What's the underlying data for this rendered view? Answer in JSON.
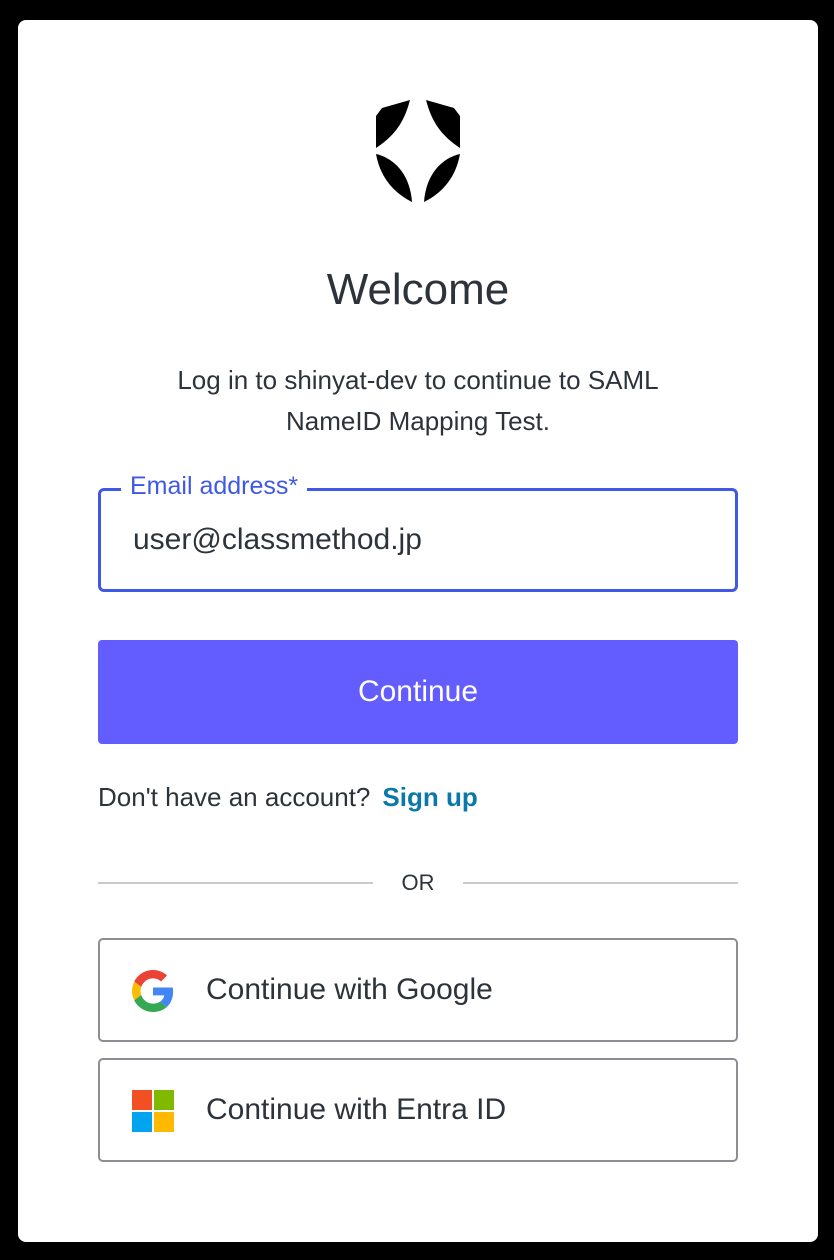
{
  "header": {
    "title": "Welcome",
    "subtitle": "Log in to shinyat-dev to continue to SAML NameID Mapping Test."
  },
  "form": {
    "email_label": "Email address*",
    "email_value": "user@classmethod.jp",
    "continue_label": "Continue"
  },
  "signup": {
    "prompt": "Don't have an account?",
    "link_label": "Sign up"
  },
  "divider": {
    "text": "OR"
  },
  "social": {
    "google_label": "Continue with Google",
    "entra_label": "Continue with Entra ID"
  },
  "icons": {
    "logo": "shield-logo-icon",
    "google": "google-icon",
    "entra": "microsoft-icon"
  },
  "colors": {
    "primary_button": "#635dff",
    "focus_border": "#3f59e4",
    "link": "#0a78a8",
    "text": "#2d333a"
  }
}
